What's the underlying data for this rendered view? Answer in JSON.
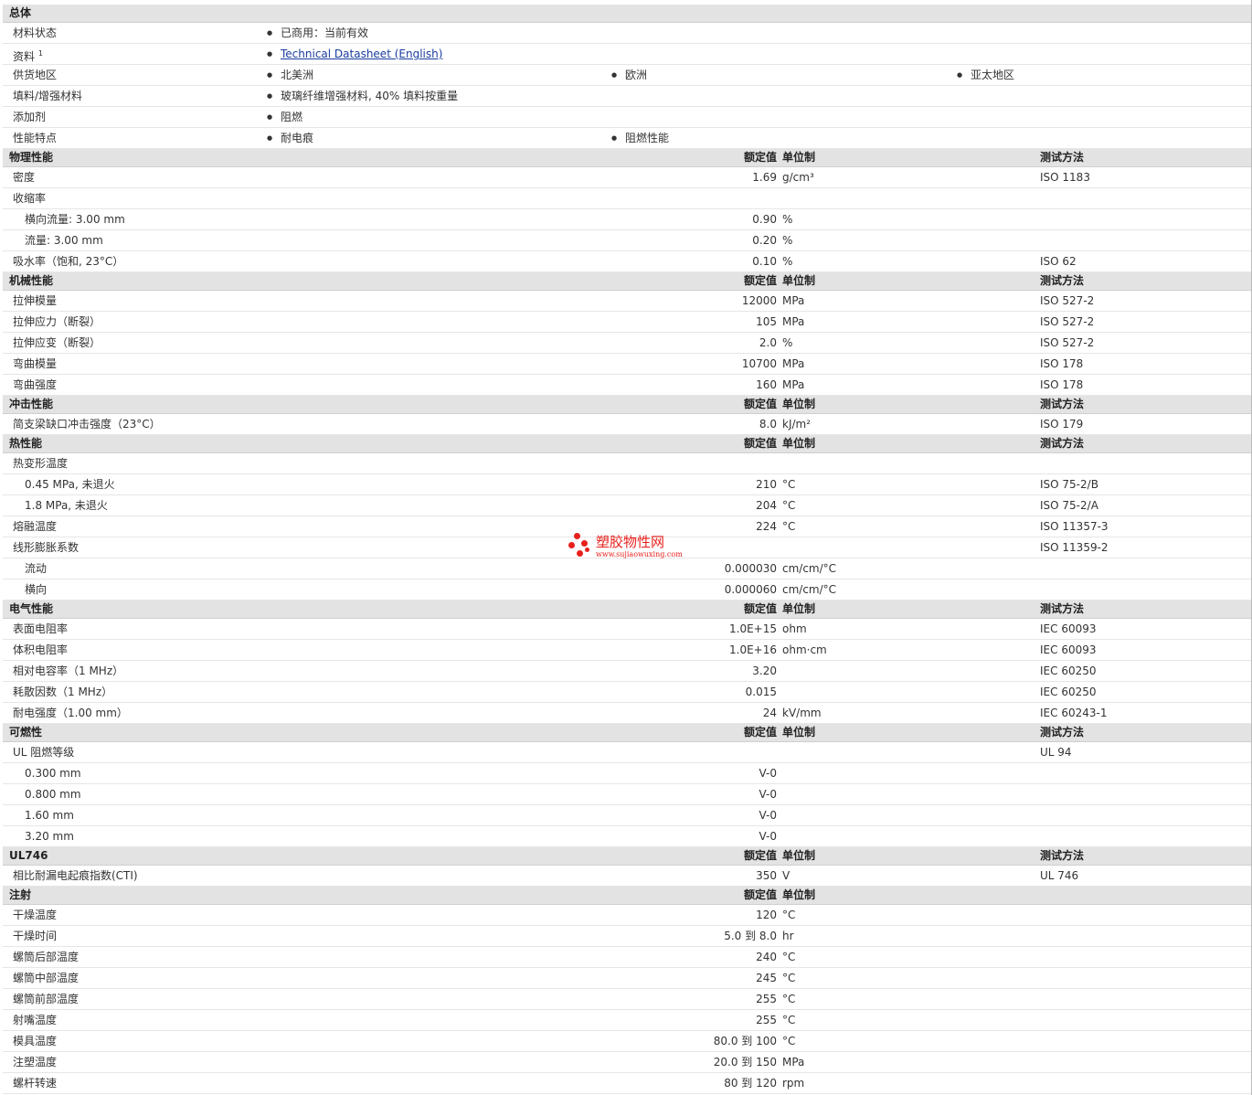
{
  "general": {
    "title": "总体",
    "material_status": {
      "label": "材料状态",
      "value": "已商用：当前有效"
    },
    "info": {
      "label": "资料",
      "sup": "1",
      "link": "Technical Datasheet (English)"
    },
    "supply": {
      "label": "供货地区",
      "values": [
        "北美洲",
        "欧洲",
        "亚太地区"
      ]
    },
    "filler": {
      "label": "填料/增强材料",
      "value": "玻璃纤维增强材料, 40% 填料按重量"
    },
    "additive": {
      "label": "添加剂",
      "value": "阻燃"
    },
    "features": {
      "label": "性能特点",
      "values": [
        "耐电痕",
        "阻燃性能"
      ]
    }
  },
  "headers": {
    "nominal": "额定值",
    "unit": "单位制",
    "test": "测试方法"
  },
  "sections": [
    {
      "title": "物理性能",
      "test_header": true,
      "rows": [
        {
          "label": "密度",
          "value": "1.69",
          "unit": "g/cm³",
          "test": "ISO 1183"
        },
        {
          "label": "收缩率",
          "value": "",
          "unit": "",
          "test": ""
        },
        {
          "label": "横向流量: 3.00 mm",
          "sub": true,
          "value": "0.90",
          "unit": "%",
          "test": ""
        },
        {
          "label": "流量: 3.00 mm",
          "sub": true,
          "value": "0.20",
          "unit": "%",
          "test": ""
        },
        {
          "label": "吸水率（饱和, 23°C）",
          "value": "0.10",
          "unit": "%",
          "test": "ISO 62"
        }
      ]
    },
    {
      "title": "机械性能",
      "test_header": true,
      "rows": [
        {
          "label": "拉伸模量",
          "value": "12000",
          "unit": "MPa",
          "test": "ISO 527-2"
        },
        {
          "label": "拉伸应力（断裂）",
          "value": "105",
          "unit": "MPa",
          "test": "ISO 527-2"
        },
        {
          "label": "拉伸应变（断裂）",
          "value": "2.0",
          "unit": "%",
          "test": "ISO 527-2"
        },
        {
          "label": "弯曲模量",
          "value": "10700",
          "unit": "MPa",
          "test": "ISO 178"
        },
        {
          "label": "弯曲强度",
          "value": "160",
          "unit": "MPa",
          "test": "ISO 178"
        }
      ]
    },
    {
      "title": "冲击性能",
      "test_header": true,
      "rows": [
        {
          "label": "简支梁缺口冲击强度（23°C）",
          "value": "8.0",
          "unit": "kJ/m²",
          "test": "ISO 179"
        }
      ]
    },
    {
      "title": "热性能",
      "test_header": true,
      "rows": [
        {
          "label": "热变形温度",
          "value": "",
          "unit": "",
          "test": ""
        },
        {
          "label": "0.45 MPa, 未退火",
          "sub": true,
          "value": "210",
          "unit": "°C",
          "test": "ISO 75-2/B"
        },
        {
          "label": "1.8 MPa, 未退火",
          "sub": true,
          "value": "204",
          "unit": "°C",
          "test": "ISO 75-2/A"
        },
        {
          "label": "熔融温度",
          "value": "224",
          "unit": "°C",
          "test": "ISO 11357-3"
        },
        {
          "label": "线形膨胀系数",
          "value": "",
          "unit": "",
          "test": "ISO 11359-2"
        },
        {
          "label": "流动",
          "sub": true,
          "value": "0.000030",
          "unit": "cm/cm/°C",
          "test": ""
        },
        {
          "label": "横向",
          "sub": true,
          "value": "0.000060",
          "unit": "cm/cm/°C",
          "test": ""
        }
      ]
    },
    {
      "title": "电气性能",
      "test_header": true,
      "rows": [
        {
          "label": "表面电阻率",
          "value": "1.0E+15",
          "unit": "ohm",
          "test": "IEC 60093"
        },
        {
          "label": "体积电阻率",
          "value": "1.0E+16",
          "unit": "ohm·cm",
          "test": "IEC 60093"
        },
        {
          "label": "相对电容率（1 MHz）",
          "value": "3.20",
          "unit": "",
          "test": "IEC 60250"
        },
        {
          "label": "耗散因数（1 MHz）",
          "value": "0.015",
          "unit": "",
          "test": "IEC 60250"
        },
        {
          "label": "耐电强度（1.00 mm）",
          "value": "24",
          "unit": "kV/mm",
          "test": "IEC 60243-1"
        }
      ]
    },
    {
      "title": "可燃性",
      "test_header": true,
      "rows": [
        {
          "label": "UL 阻燃等级",
          "value": "",
          "unit": "",
          "test": "UL 94"
        },
        {
          "label": "0.300 mm",
          "sub": true,
          "value": "V-0",
          "unit": "",
          "test": ""
        },
        {
          "label": "0.800 mm",
          "sub": true,
          "value": "V-0",
          "unit": "",
          "test": ""
        },
        {
          "label": "1.60 mm",
          "sub": true,
          "value": "V-0",
          "unit": "",
          "test": ""
        },
        {
          "label": "3.20 mm",
          "sub": true,
          "value": "V-0",
          "unit": "",
          "test": ""
        }
      ]
    },
    {
      "title": "UL746",
      "test_header": true,
      "rows": [
        {
          "label": "相比耐漏电起痕指数(CTI)",
          "value": "350",
          "unit": "V",
          "test": "UL 746"
        }
      ]
    },
    {
      "title": "注射",
      "test_header": false,
      "rows": [
        {
          "label": "干燥温度",
          "value": "120",
          "unit": "°C",
          "test": ""
        },
        {
          "label": "干燥时间",
          "value": "5.0 到  8.0",
          "unit": "hr",
          "test": ""
        },
        {
          "label": "螺筒后部温度",
          "value": "240",
          "unit": "°C",
          "test": ""
        },
        {
          "label": "螺筒中部温度",
          "value": "245",
          "unit": "°C",
          "test": ""
        },
        {
          "label": "螺筒前部温度",
          "value": "255",
          "unit": "°C",
          "test": ""
        },
        {
          "label": "射嘴温度",
          "value": "255",
          "unit": "°C",
          "test": ""
        },
        {
          "label": "模具温度",
          "value": "80.0 到  100",
          "unit": "°C",
          "test": ""
        },
        {
          "label": "注塑温度",
          "value": "20.0 到  150",
          "unit": "MPa",
          "test": ""
        },
        {
          "label": "螺杆转速",
          "value": "80 到  120",
          "unit": "rpm",
          "test": ""
        }
      ]
    }
  ],
  "watermark": {
    "text": "塑胶物性网",
    "url": "www.sujiaowuxing.com",
    "color": "#e8201c"
  }
}
